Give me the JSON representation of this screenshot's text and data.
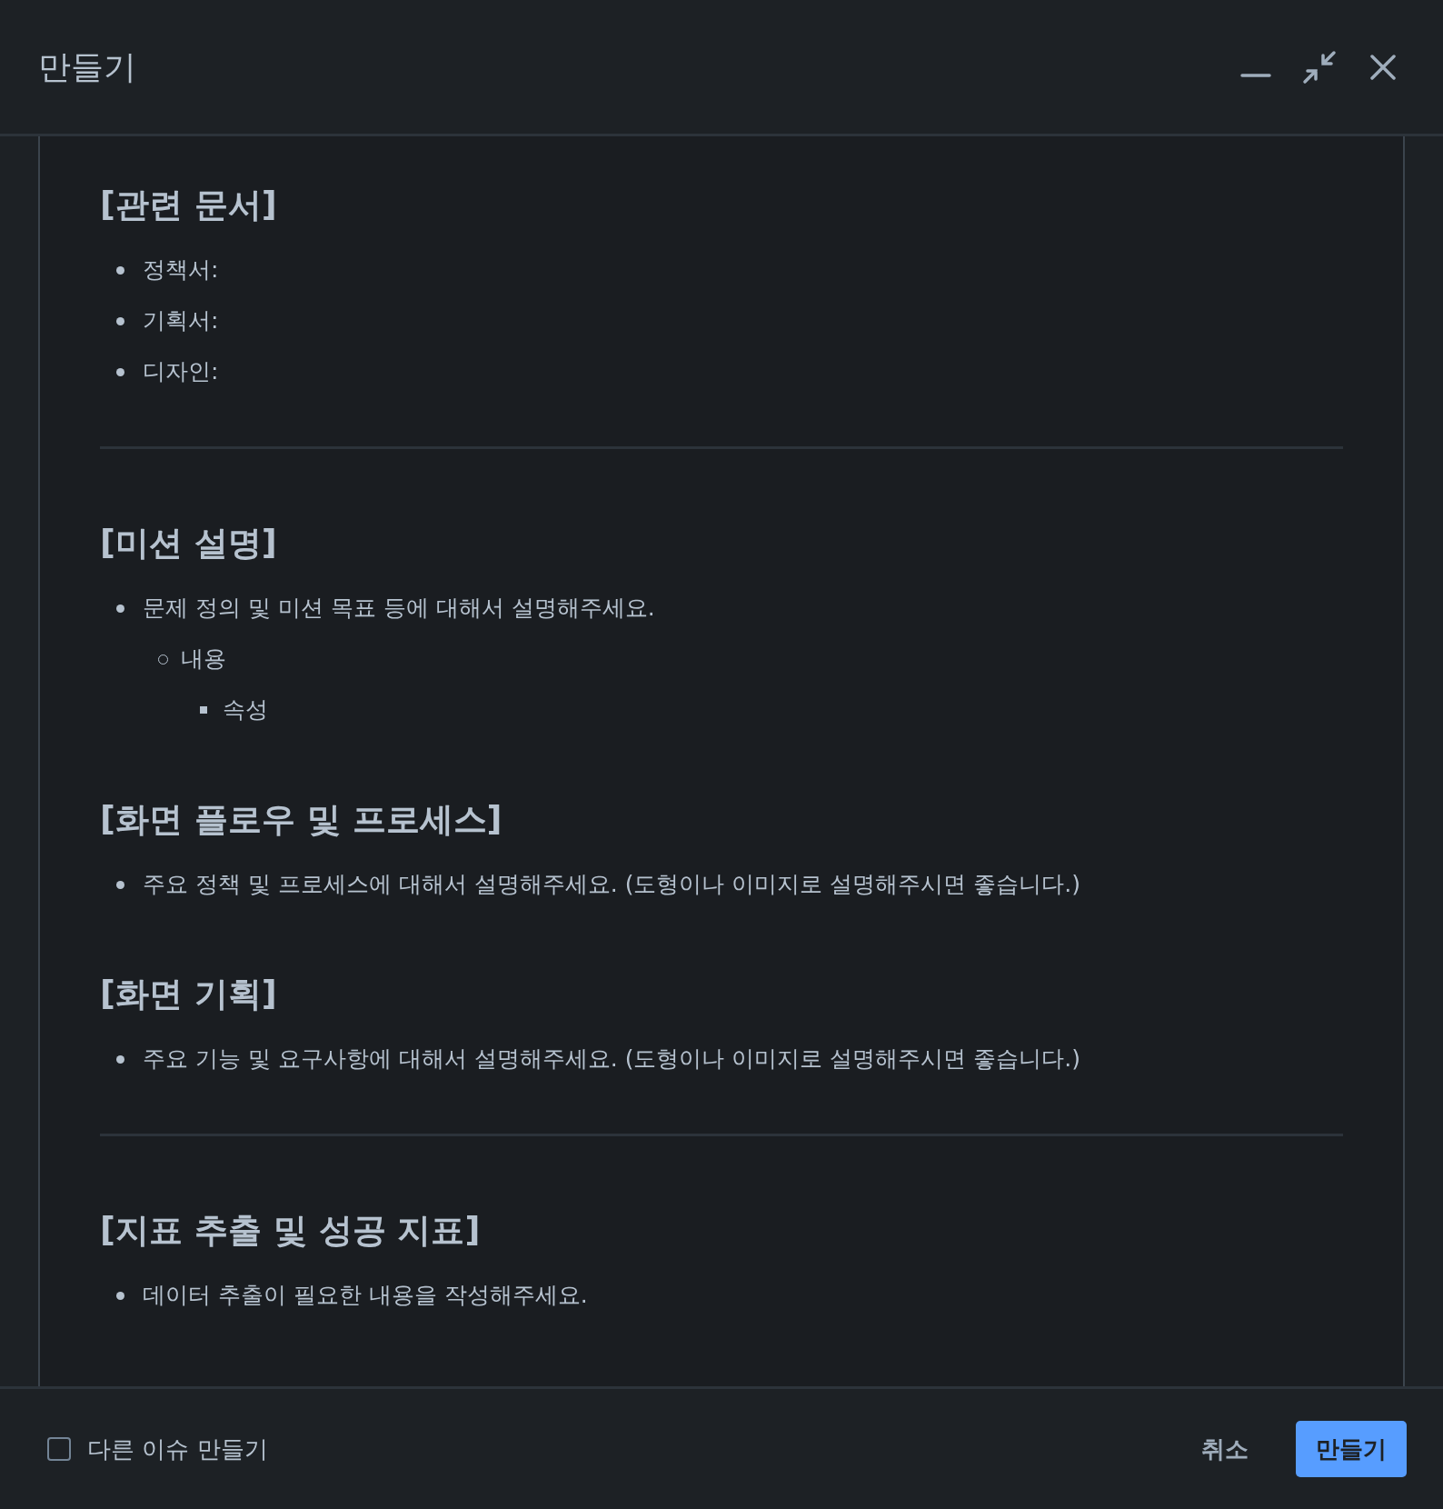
{
  "dialog": {
    "title": "만들기"
  },
  "editor": {
    "blocks": [
      {
        "kind": "heading",
        "text": "[관련 문서]"
      },
      {
        "kind": "list",
        "items": [
          {
            "text": "정책서:"
          },
          {
            "text": "기획서:"
          },
          {
            "text": "디자인:"
          }
        ]
      },
      {
        "kind": "divider"
      },
      {
        "kind": "heading",
        "text": "[미션 설명]"
      },
      {
        "kind": "list",
        "items": [
          {
            "text": "문제 정의 및 미션 목표 등에 대해서 설명해주세요.",
            "children": [
              {
                "text": "내용",
                "children": [
                  {
                    "text": "속성"
                  }
                ]
              }
            ]
          }
        ]
      },
      {
        "kind": "heading",
        "text": "[화면 플로우 및 프로세스]"
      },
      {
        "kind": "list",
        "items": [
          {
            "text": "주요 정책 및 프로세스에 대해서 설명해주세요. (도형이나 이미지로 설명해주시면 좋습니다.)"
          }
        ]
      },
      {
        "kind": "heading",
        "text": "[화면 기획]"
      },
      {
        "kind": "list",
        "items": [
          {
            "text": "주요 기능 및 요구사항에 대해서 설명해주세요. (도형이나 이미지로 설명해주시면 좋습니다.)"
          }
        ]
      },
      {
        "kind": "divider"
      },
      {
        "kind": "heading",
        "text": "[지표 추출 및 성공 지표]"
      },
      {
        "kind": "list",
        "items": [
          {
            "text": "데이터 추출이 필요한 내용을 작성해주세요."
          }
        ]
      }
    ]
  },
  "footer": {
    "create_another": {
      "label": "다른 이슈 만들기",
      "checked": false
    },
    "cancel": "취소",
    "submit": "만들기"
  }
}
